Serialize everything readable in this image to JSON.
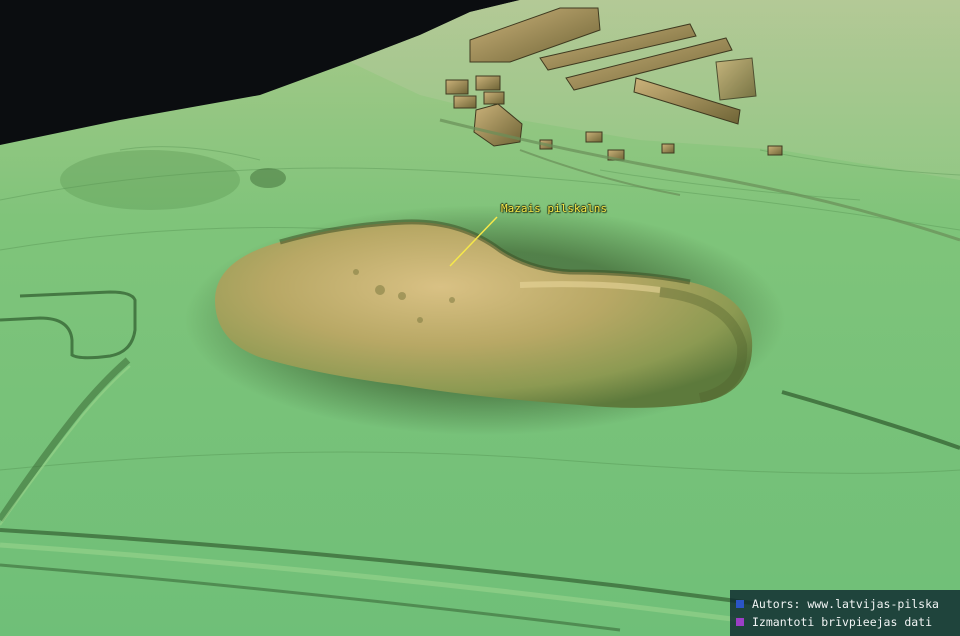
{
  "map": {
    "label": "Mazais pilskalns"
  },
  "credits": [
    {
      "text": "Autors: www.latvijas-pilska",
      "color": "#2b55c6"
    },
    {
      "text": "Izmantoti brīvpieejas dati",
      "color": "#9b3fc6"
    }
  ],
  "colors": {
    "sky": "#0b0d10",
    "terrain_low": "#7fc47a",
    "terrain_high": "#c9b070",
    "label": "#f6e84a"
  }
}
